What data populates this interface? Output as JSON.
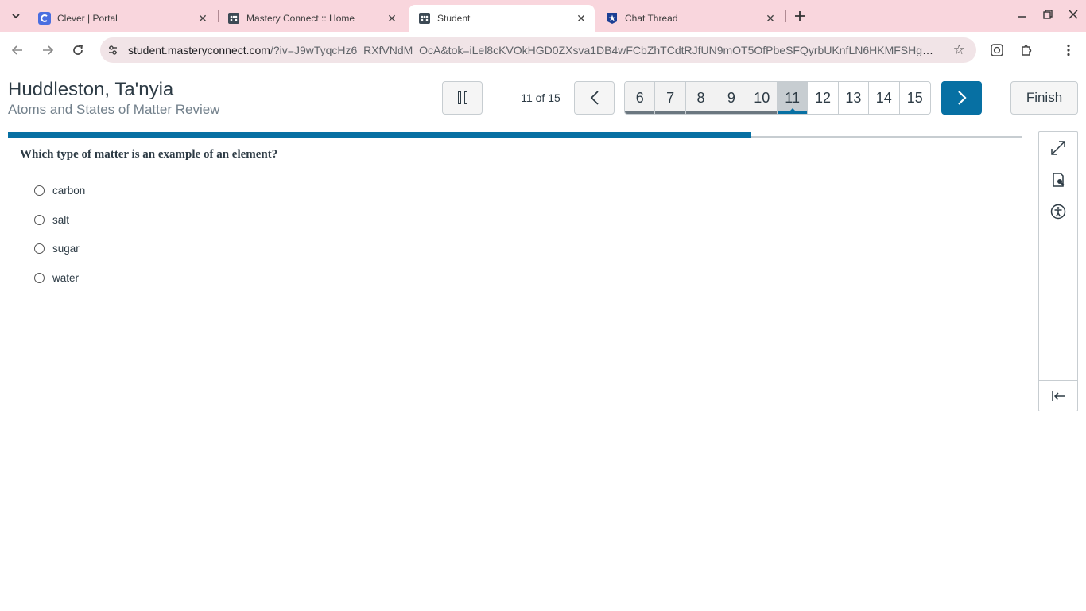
{
  "browser": {
    "tabs": [
      {
        "title": "Clever | Portal",
        "favicon": "clever-icon",
        "active": false
      },
      {
        "title": "Mastery Connect :: Home",
        "favicon": "masteryconnect-icon",
        "active": false
      },
      {
        "title": "Student",
        "favicon": "masteryconnect-icon",
        "active": true
      },
      {
        "title": "Chat Thread",
        "favicon": "star-badge-icon",
        "active": false
      }
    ],
    "url_host": "student.masteryconnect.com",
    "url_path": "/?iv=J9wTyqcHz6_RXfVNdM_OcA&tok=iLel8cKVOkHGD0ZXsva1DB4wFCbZhTCdtRJfUN9mOT5OfPbeSFQyrbUKnfLN6HKMFSHgCP..."
  },
  "header": {
    "student_name": "Huddleston, Ta'nyia",
    "assessment_title": "Atoms and States of Matter Review",
    "counter": "11 of 15",
    "pages": [
      "6",
      "7",
      "8",
      "9",
      "10",
      "11",
      "12",
      "13",
      "14",
      "15"
    ],
    "current_page": "11",
    "finish_label": "Finish"
  },
  "progress": {
    "fraction": 0.733
  },
  "question": {
    "text": "Which type of matter is an example of an element?",
    "options": [
      "carbon",
      "salt",
      "sugar",
      "water"
    ]
  },
  "colors": {
    "accent": "#0770a3",
    "tabstrip": "#f9d6dd",
    "text": "#2d3b45",
    "border": "#c7cdd1"
  }
}
